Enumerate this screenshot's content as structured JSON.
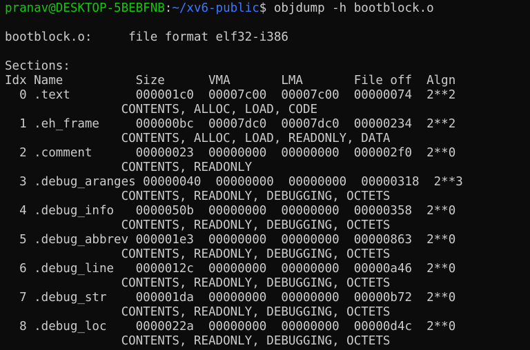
{
  "colors": {
    "background": "#0c0c0c",
    "foreground": "#cccccc",
    "prompt_user": "#16c60c",
    "prompt_path": "#3b78ff"
  },
  "prompt": {
    "user_host": "pranav@DESKTOP-5BEBFNB",
    "separator": ":",
    "path": "~/xv6-public",
    "symbol": "$ ",
    "command": "objdump -h bootblock.o"
  },
  "output": {
    "file_line": "bootblock.o:     file format elf32-i386",
    "sections_label": "Sections:",
    "header": "Idx Name          Size      VMA       LMA       File off  Algn",
    "rows": [
      {
        "main": "  0 .text         000001c0  00007c00  00007c00  00000074  2**2",
        "flags": "                CONTENTS, ALLOC, LOAD, CODE"
      },
      {
        "main": "  1 .eh_frame     000000bc  00007dc0  00007dc0  00000234  2**2",
        "flags": "                CONTENTS, ALLOC, LOAD, READONLY, DATA"
      },
      {
        "main": "  2 .comment      00000023  00000000  00000000  000002f0  2**0",
        "flags": "                CONTENTS, READONLY"
      },
      {
        "main": "  3 .debug_aranges 00000040  00000000  00000000  00000318  2**3",
        "flags": "                CONTENTS, READONLY, DEBUGGING, OCTETS"
      },
      {
        "main": "  4 .debug_info   0000050b  00000000  00000000  00000358  2**0",
        "flags": "                CONTENTS, READONLY, DEBUGGING, OCTETS"
      },
      {
        "main": "  5 .debug_abbrev 000001e3  00000000  00000000  00000863  2**0",
        "flags": "                CONTENTS, READONLY, DEBUGGING, OCTETS"
      },
      {
        "main": "  6 .debug_line   0000012c  00000000  00000000  00000a46  2**0",
        "flags": "                CONTENTS, READONLY, DEBUGGING, OCTETS"
      },
      {
        "main": "  7 .debug_str    000001da  00000000  00000000  00000b72  2**0",
        "flags": "                CONTENTS, READONLY, DEBUGGING, OCTETS"
      },
      {
        "main": "  8 .debug_loc    0000022a  00000000  00000000  00000d4c  2**0",
        "flags": "                CONTENTS, READONLY, DEBUGGING, OCTETS"
      }
    ]
  }
}
